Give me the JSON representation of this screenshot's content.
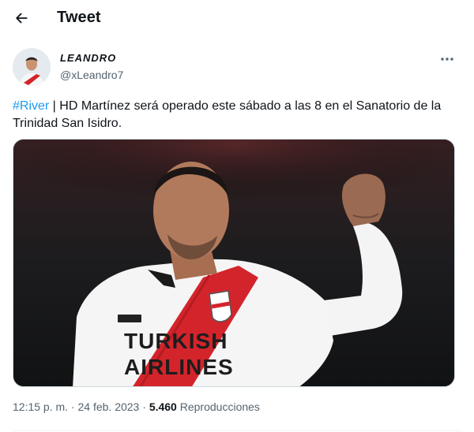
{
  "header": {
    "title": "Tweet",
    "back_icon": "arrow-left-icon"
  },
  "author": {
    "display_name": "LEANDRO",
    "handle": "@xLeandro7",
    "more_icon": "more-horizontal-icon"
  },
  "tweet": {
    "hashtag": "#River",
    "separator": " | ",
    "body": "HD Martínez será operado este sábado a las 8 en el Sanatorio de la Trinidad San Isidro."
  },
  "media": {
    "sponsor_line1": "TURKISH",
    "sponsor_line2": "AIRLINES"
  },
  "footer": {
    "time": "12:15 p. m.",
    "dot": " · ",
    "date": "24 feb. 2023",
    "dot2": " · ",
    "views_count": "5.460",
    "views_label": " Reproducciones"
  },
  "colors": {
    "accent": "#1d9bf0",
    "secondary_text": "#536471",
    "stripe_red": "#d4242b"
  }
}
